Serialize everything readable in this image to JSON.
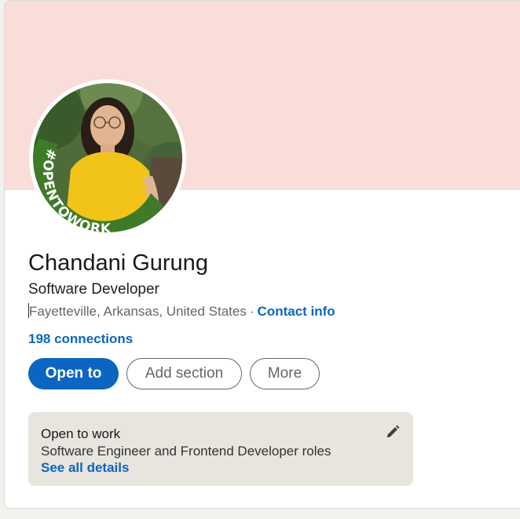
{
  "profile": {
    "name": "Chandani Gurung",
    "headline": "Software Developer",
    "location": "Fayetteville, Arkansas, United States",
    "separator": "·",
    "contact_info_label": "Contact info",
    "connections_label": "198 connections",
    "avatar_frame_text": "#OPENTOWORK"
  },
  "actions": {
    "open_to_label": "Open to",
    "add_section_label": "Add section",
    "more_label": "More"
  },
  "open_to_work": {
    "title": "Open to work",
    "description": "Software Engineer and Frontend Developer roles",
    "see_all_label": "See all details",
    "edit_icon": "pencil-icon"
  },
  "colors": {
    "banner": "#f8ddd8",
    "primary": "#0a66c2",
    "otw_frame_green": "#3e7b27",
    "card_bg": "#ffffff",
    "otw_box_bg": "#e8e5df"
  }
}
